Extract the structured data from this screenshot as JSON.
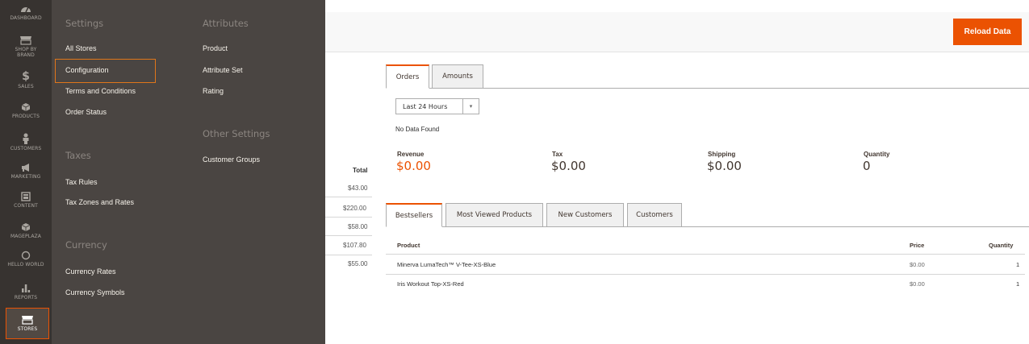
{
  "colors": {
    "accent": "#eb5202",
    "nav_bg": "#373330",
    "flyout_bg": "#4a4542"
  },
  "nav": [
    {
      "label": "DASHBOARD",
      "icon": "dashboard-icon"
    },
    {
      "label": "SHOP BY BRAND",
      "label2": "BRAND",
      "icon": "store-front-icon"
    },
    {
      "label": "SALES",
      "icon": "dollar-icon"
    },
    {
      "label": "PRODUCTS",
      "icon": "cube-icon"
    },
    {
      "label": "CUSTOMERS",
      "icon": "person-icon"
    },
    {
      "label": "MARKETING",
      "icon": "megaphone-icon"
    },
    {
      "label": "CONTENT",
      "icon": "layout-icon"
    },
    {
      "label": "MAGEPLAZA",
      "icon": "cube-icon"
    },
    {
      "label": "HELLO WORLD",
      "icon": "circle-icon"
    },
    {
      "label": "REPORTS",
      "icon": "bar-chart-icon"
    },
    {
      "label": "STORES",
      "icon": "store-front-icon"
    }
  ],
  "flyout": {
    "settings_title": "Settings",
    "settings": [
      "All Stores",
      "Configuration",
      "Terms and Conditions",
      "Order Status"
    ],
    "taxes_title": "Taxes",
    "taxes": [
      "Tax Rules",
      "Tax Zones and Rates"
    ],
    "currency_title": "Currency",
    "currency": [
      "Currency Rates",
      "Currency Symbols"
    ],
    "attributes_title": "Attributes",
    "attributes": [
      "Product",
      "Attribute Set",
      "Rating"
    ],
    "other_title": "Other Settings",
    "other": [
      "Customer Groups"
    ]
  },
  "header": {
    "reload_label": "Reload Data"
  },
  "orders_panel": {
    "tabs": [
      "Orders",
      "Amounts"
    ],
    "period": "Last 24 Hours",
    "no_data": "No Data Found"
  },
  "metrics": [
    {
      "label": "Revenue",
      "value": "$0.00"
    },
    {
      "label": "Tax",
      "value": "$0.00"
    },
    {
      "label": "Shipping",
      "value": "$0.00"
    },
    {
      "label": "Quantity",
      "value": "0"
    }
  ],
  "bg_totals": {
    "header": "Total",
    "values": [
      "$43.00",
      "$220.00",
      "$58.00",
      "$107.80",
      "$55.00"
    ]
  },
  "grid_panel": {
    "tabs": [
      "Bestsellers",
      "Most Viewed Products",
      "New Customers",
      "Customers"
    ],
    "columns": [
      "Product",
      "Price",
      "Quantity"
    ],
    "rows": [
      [
        "Minerva LumaTech™ V-Tee-XS-Blue",
        "$0.00",
        "1"
      ],
      [
        "Iris Workout Top-XS-Red",
        "$0.00",
        "1"
      ]
    ]
  }
}
